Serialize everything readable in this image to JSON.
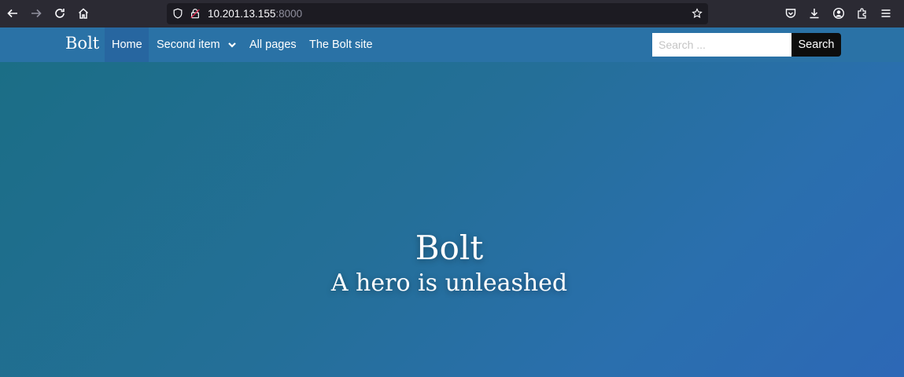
{
  "browser": {
    "url_host": "10.201.13.155",
    "url_port": ":8000"
  },
  "site": {
    "brand": "Bolt",
    "nav": [
      {
        "label": "Home",
        "active": true
      },
      {
        "label": "Second item",
        "has_dropdown": true
      },
      {
        "label": "All pages"
      },
      {
        "label": "The Bolt site"
      }
    ],
    "search_placeholder": "Search ...",
    "search_button": "Search"
  },
  "hero": {
    "title": "Bolt",
    "subtitle": "A hero is unleashed"
  },
  "colors": {
    "navbar": "#2a72a6",
    "nav_active": "#2766a0",
    "hero_gradient_start": "#1b6e86",
    "hero_gradient_end": "#2d68b6",
    "search_button": "#0d0d0d"
  },
  "icons": [
    "back-icon",
    "forward-icon",
    "reload-icon",
    "home-icon",
    "shield-icon",
    "insecure-lock-icon",
    "bookmark-star-icon",
    "pocket-icon",
    "download-icon",
    "account-icon",
    "extensions-icon",
    "menu-icon",
    "chevron-down-icon"
  ]
}
